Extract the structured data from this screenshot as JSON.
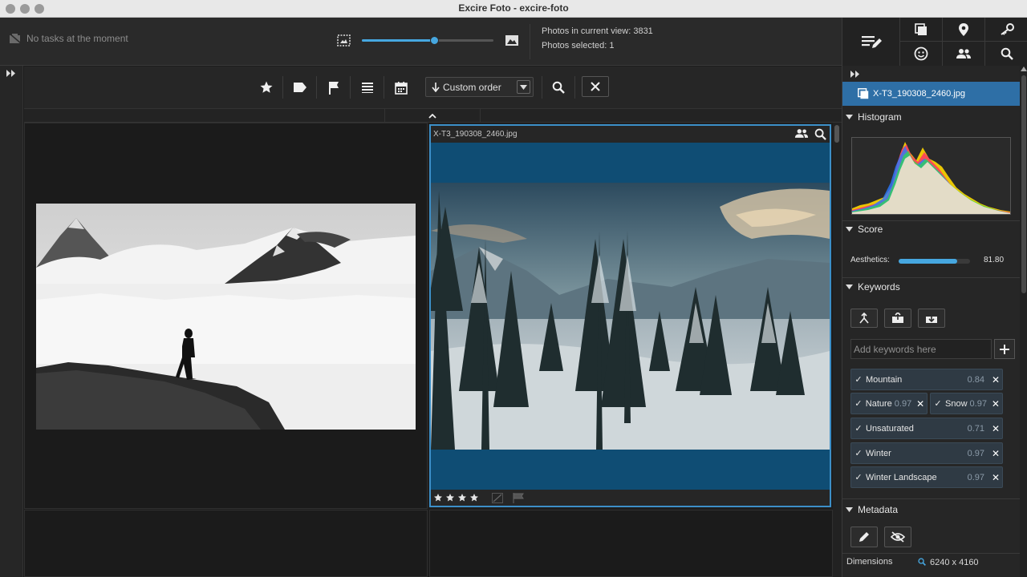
{
  "window": {
    "title": "Excire Foto - excire-foto"
  },
  "header": {
    "tasks_text": "No tasks at the moment",
    "thumbnail_size_percent": 55,
    "photos_in_view_label": "Photos in current view: 3831",
    "photos_selected_label": "Photos selected: 1"
  },
  "toolbar": {
    "icons": [
      "star-icon",
      "tag-icon",
      "flag-icon",
      "list-icon",
      "calendar-icon"
    ],
    "sort_label": "Custom order"
  },
  "grid": {
    "selected_photo": {
      "filename": "X-T3_190308_2460.jpg",
      "stars": 4
    }
  },
  "right_panel": {
    "file_name": "X-T3_190308_2460.jpg",
    "sections": {
      "histogram": "Histogram",
      "score": "Score",
      "keywords": "Keywords",
      "metadata": "Metadata"
    },
    "score": {
      "label": "Aesthetics:",
      "value": "81.80",
      "value_percent": 81.8
    },
    "keywords": {
      "placeholder": "Add keywords here",
      "items": [
        {
          "name": "Mountain",
          "score": "0.84"
        },
        {
          "name": "Nature",
          "score": "0.97"
        },
        {
          "name": "Snow",
          "score": "0.97"
        },
        {
          "name": "Unsaturated",
          "score": "0.71"
        },
        {
          "name": "Winter",
          "score": "0.97"
        },
        {
          "name": "Winter Landscape",
          "score": "0.97"
        }
      ]
    },
    "metadata": {
      "dimensions_label": "Dimensions",
      "dimensions_value": "6240 x 4160"
    }
  },
  "colors": {
    "accent": "#46a7e0",
    "selection": "#2e6fa6",
    "background": "#1d1d1d"
  }
}
